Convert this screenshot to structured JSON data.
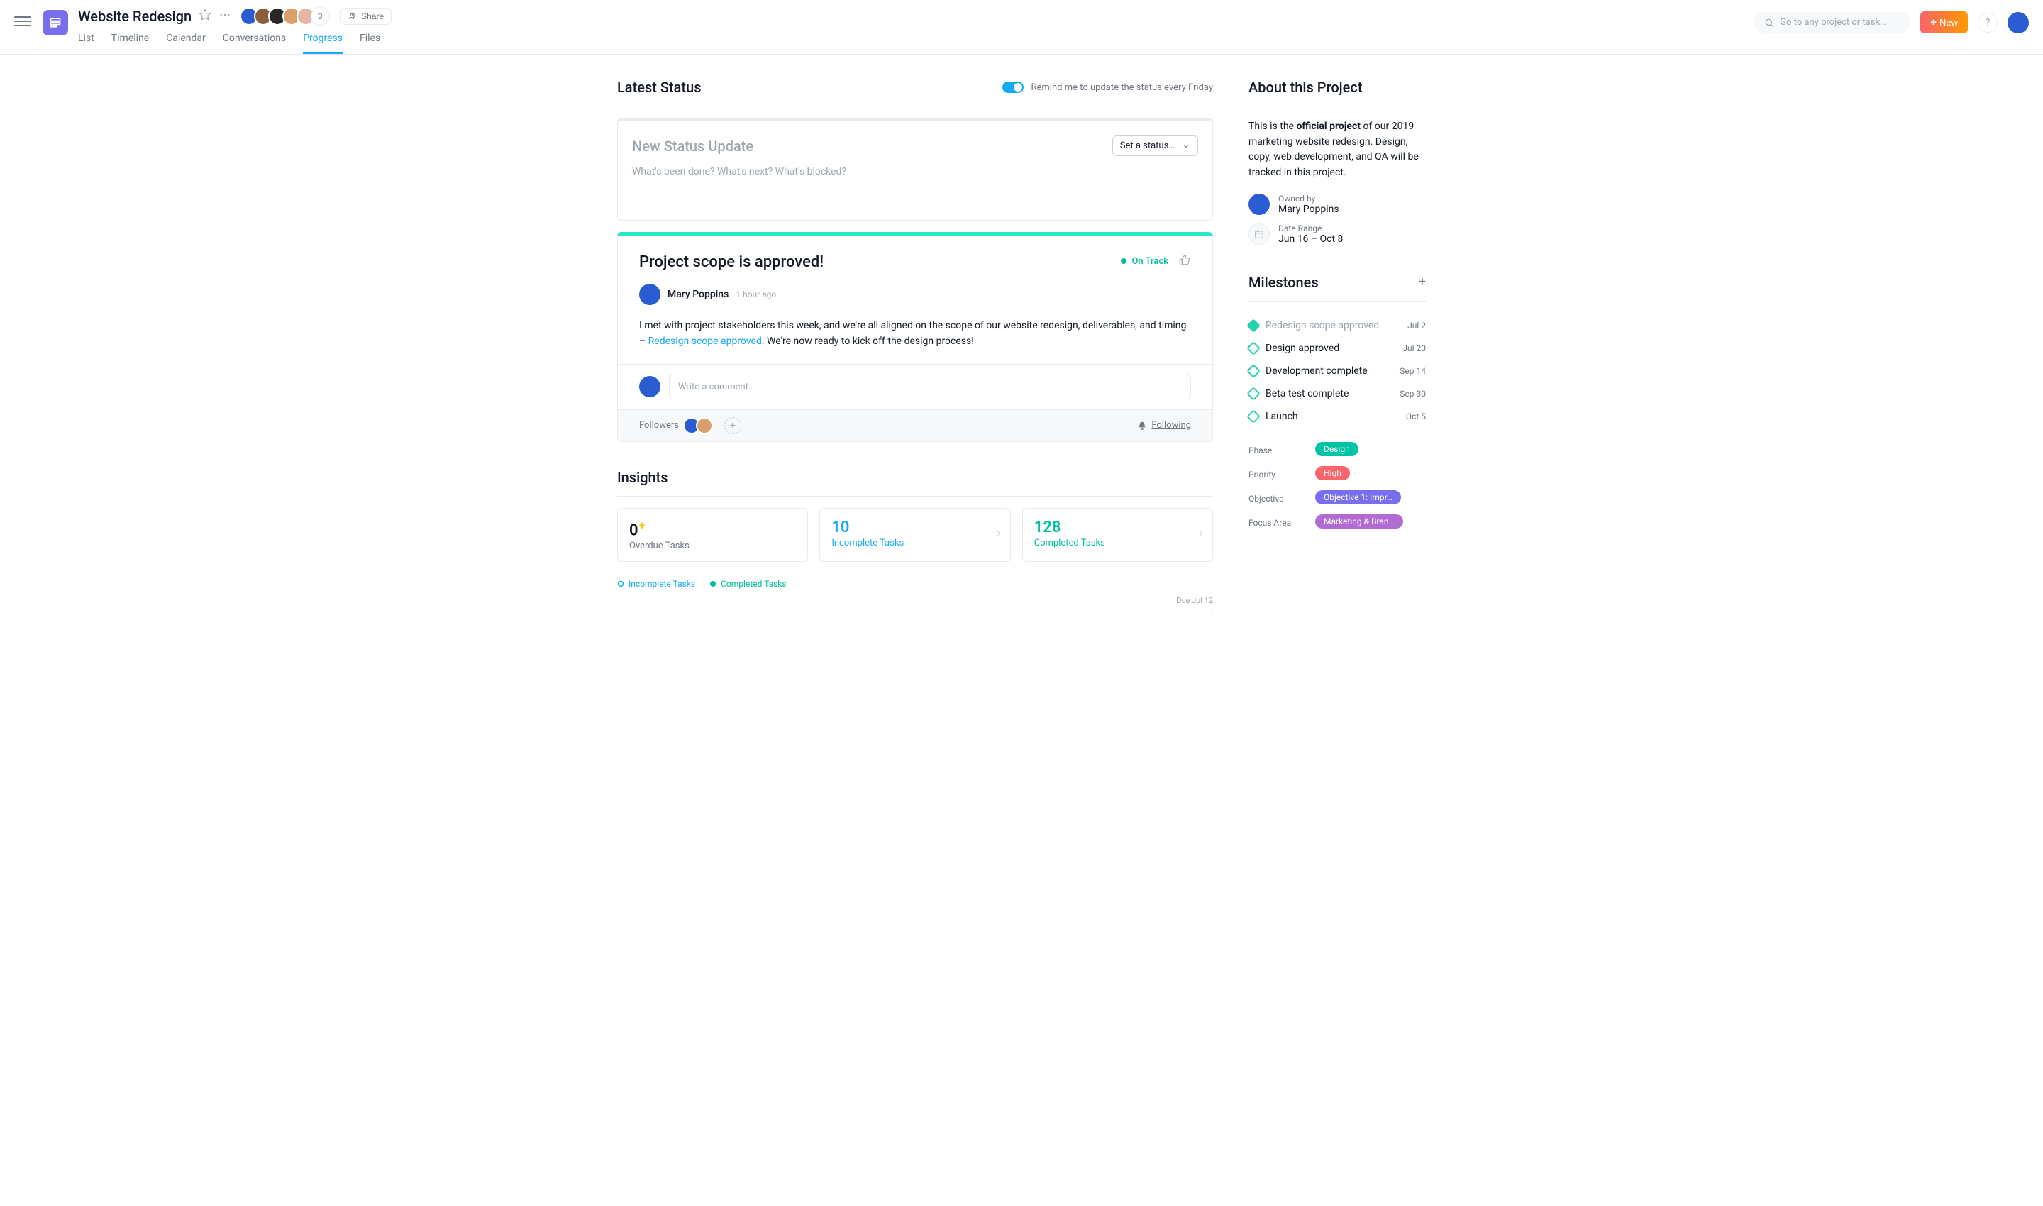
{
  "header": {
    "project_title": "Website Redesign",
    "extra_members": "3",
    "share_label": "Share",
    "search_placeholder": "Go to any project or task…",
    "new_label": "New",
    "tabs": [
      "List",
      "Timeline",
      "Calendar",
      "Conversations",
      "Progress",
      "Files"
    ]
  },
  "status": {
    "section_title": "Latest Status",
    "reminder_text": "Remind me to update the status every Friday",
    "composer_title": "New Status Update",
    "composer_placeholder": "What's been done? What's next? What's blocked?",
    "status_select_label": "Set a status…"
  },
  "update": {
    "title": "Project scope is approved!",
    "badge": "On Track",
    "author": "Mary Poppins",
    "time": "1 hour ago",
    "body_prefix": "I met with project stakeholders this week, and we're all aligned on the scope of our website redesign, deliverables, and timing – ",
    "body_link": "Redesign scope approved",
    "body_suffix": ". We're now ready to kick off the design process!",
    "comment_placeholder": "Write a comment…",
    "followers_label": "Followers",
    "following_label": "Following"
  },
  "insights": {
    "title": "Insights",
    "overdue": {
      "num": "0",
      "label": "Overdue Tasks"
    },
    "incomplete": {
      "num": "10",
      "label": "Incomplete Tasks"
    },
    "complete": {
      "num": "128",
      "label": "Completed Tasks"
    },
    "legend_incomplete": "Incomplete Tasks",
    "legend_complete": "Completed Tasks",
    "chart_due": "Due Jul 12",
    "chart_tick": "|"
  },
  "about": {
    "title": "About this Project",
    "text_prefix": "This is the ",
    "text_bold": "official project",
    "text_suffix": " of our 2019 marketing website redesign. Design, copy, web development, and QA will be tracked in this project.",
    "owned_label": "Owned by",
    "owner": "Mary Poppins",
    "range_label": "Date Range",
    "range": "Jun 16 – Oct 8"
  },
  "milestones": {
    "title": "Milestones",
    "items": [
      {
        "label": "Redesign scope approved",
        "date": "Jul 2",
        "done": true
      },
      {
        "label": "Design approved",
        "date": "Jul 20",
        "done": false
      },
      {
        "label": "Development complete",
        "date": "Sep 14",
        "done": false
      },
      {
        "label": "Beta test complete",
        "date": "Sep 30",
        "done": false
      },
      {
        "label": "Launch",
        "date": "Oct 5",
        "done": false
      }
    ]
  },
  "properties": {
    "labels": {
      "phase": "Phase",
      "priority": "Priority",
      "objective": "Objective",
      "focus": "Focus Area"
    },
    "phase": "Design",
    "priority": "High",
    "objective": "Objective 1: Impr…",
    "focus": "Marketing & Bran…",
    "colors": {
      "phase": "#00C4A5",
      "priority": "#FC636B",
      "objective": "#796EEE",
      "focus": "#B36BD4"
    }
  },
  "avatar_colors": [
    "#2A5DD1",
    "#8B5E3C",
    "#272727",
    "#D8A06B",
    "#E3B8A5"
  ]
}
